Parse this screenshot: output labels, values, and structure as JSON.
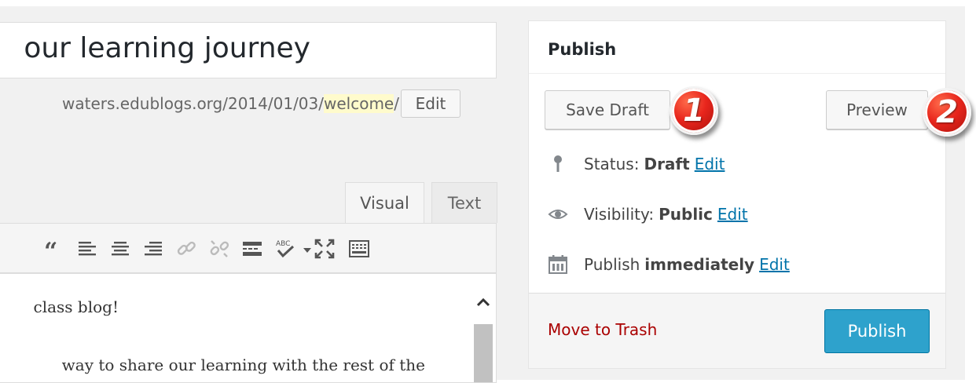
{
  "post": {
    "title_visible": "our learning journey",
    "permalink_prefix": "waters.edublogs.org/2014/01/03/",
    "permalink_slug": "welcome",
    "permalink_suffix": "/",
    "permalink_edit_label": "Edit"
  },
  "editor": {
    "tabs": [
      {
        "label": "Visual",
        "active": true
      },
      {
        "label": "Text",
        "active": false
      }
    ],
    "toolbar_icons": [
      "blockquote-icon",
      "align-left-icon",
      "align-center-icon",
      "align-right-icon",
      "insert-link-icon",
      "remove-link-icon",
      "read-more-icon",
      "spellcheck-icon",
      "fullscreen-icon",
      "toolbar-toggle-icon"
    ],
    "content_lines": [
      "class blog!",
      "way to share our learning with the rest of the"
    ]
  },
  "publish": {
    "title": "Publish",
    "save_draft_label": "Save Draft",
    "preview_label": "Preview",
    "status_label": "Status:",
    "status_value": "Draft",
    "visibility_label": "Visibility:",
    "visibility_value": "Public",
    "schedule_label": "Publish",
    "schedule_value": "immediately",
    "edit_link": "Edit",
    "move_to_trash_label": "Move to Trash",
    "publish_button_label": "Publish"
  },
  "callouts": [
    "1",
    "2"
  ],
  "colors": {
    "primary_button": "#2ea2cc",
    "link": "#0073aa",
    "trash": "#aa0000",
    "slug_highlight": "#fffbcc",
    "callout_red": "#e8251c"
  }
}
